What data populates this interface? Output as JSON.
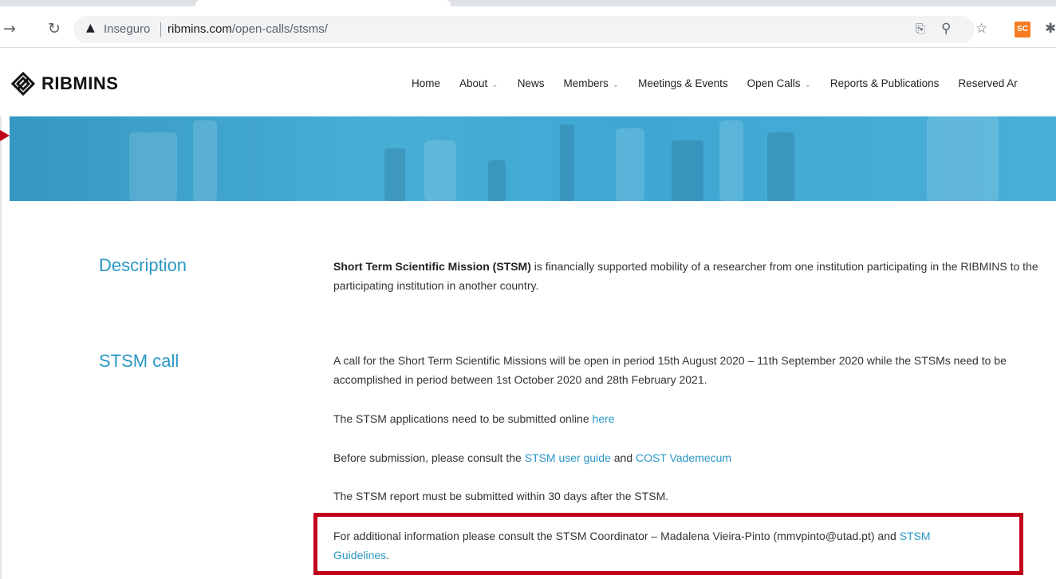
{
  "browser": {
    "security_label": "Inseguro",
    "url_host": "ribmins.com",
    "url_path": "/open-calls/stsms/",
    "extension_label": "SC"
  },
  "site": {
    "logo_text": "RIBMINS",
    "nav": [
      {
        "label": "Home",
        "has_dropdown": false
      },
      {
        "label": "About",
        "has_dropdown": true
      },
      {
        "label": "News",
        "has_dropdown": false
      },
      {
        "label": "Members",
        "has_dropdown": true
      },
      {
        "label": "Meetings & Events",
        "has_dropdown": false
      },
      {
        "label": "Open Calls",
        "has_dropdown": true
      },
      {
        "label": "Reports & Publications",
        "has_dropdown": false
      },
      {
        "label": "Reserved Ar",
        "has_dropdown": false
      }
    ]
  },
  "description": {
    "title": "Description",
    "bold_lead": "Short Term Scientific Mission (STSM)",
    "text": " is financially supported mobility of a researcher from one institution participating in the RIBMINS to the participating institution in another country."
  },
  "stsm_call": {
    "title": "STSM call",
    "p1": "A call for the Short Term Scientific Missions will be open in period 15th August 2020 – 11th September 2020 while the STSMs need to be accomplished in period between 1st October 2020 and 28th February 2021.",
    "p2_text": "The STSM applications need to be submitted online ",
    "p2_link": "here",
    "p3_text": "Before submission, please consult the ",
    "p3_link1": "STSM user guide",
    "p3_and": " and ",
    "p3_link2": "COST Vademecum",
    "p4": "The STSM report must be submitted within 30 days after the STSM.",
    "p5_text": "For additional information please consult the STSM Coordinator – Madalena Vieira-Pinto (mmvpinto@utad.pt) and ",
    "p5_link": "STSM Guidelines",
    "p5_end": "."
  },
  "colors": {
    "accent": "#2a98c5",
    "highlight_border": "#c0001a",
    "hero": "#3ea7d2"
  }
}
